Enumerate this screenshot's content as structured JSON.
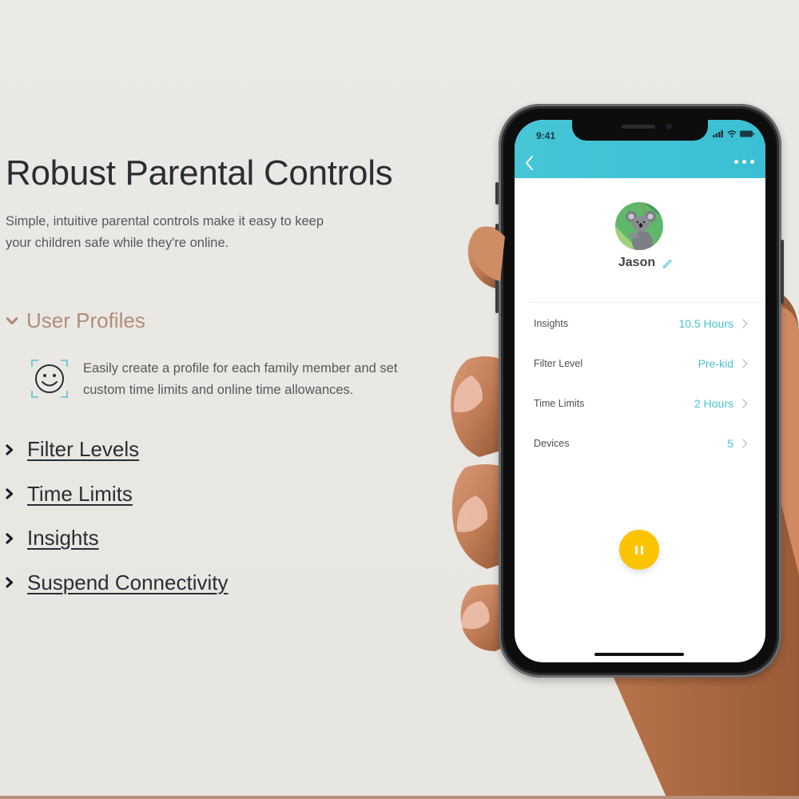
{
  "hero": {
    "title": "Robust Parental Controls",
    "subtitle": "Simple, intuitive parental controls make it easy to keep your children safe while they're online."
  },
  "features": {
    "expanded": {
      "label": "User Profiles",
      "icon": "smiley-face-icon",
      "description": "Easily create a profile for each family member and set custom time limits and online time allowances."
    },
    "collapsed": [
      {
        "label": "Filter Levels"
      },
      {
        "label": "Time Limits"
      },
      {
        "label": "Insights"
      },
      {
        "label": "Suspend Connectivity"
      }
    ]
  },
  "phone": {
    "status_time": "9:41",
    "profile_name": "Jason",
    "rows": [
      {
        "label": "Insights",
        "value": "10.5 Hours"
      },
      {
        "label": "Filter Level",
        "value": "Pre-kid"
      },
      {
        "label": "Time Limits",
        "value": "2 Hours"
      },
      {
        "label": "Devices",
        "value": "5"
      }
    ]
  },
  "colors": {
    "accent_teal": "#46c6d6",
    "section_head": "#b08d7a",
    "pause_button": "#fcc400"
  }
}
